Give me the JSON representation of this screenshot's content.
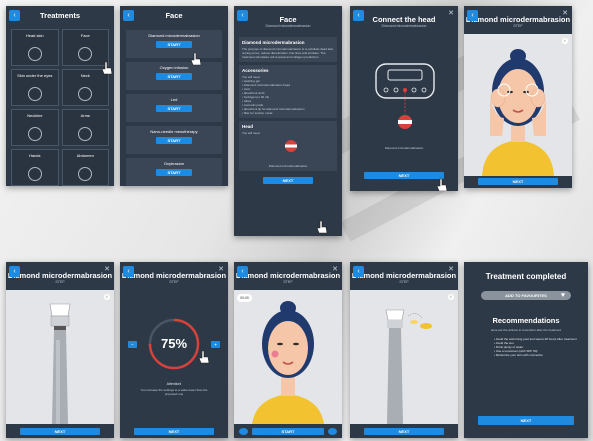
{
  "screens": {
    "treatments": {
      "title": "Treatments",
      "items": [
        {
          "label": "Head skin",
          "icon": "head-icon"
        },
        {
          "label": "Face",
          "icon": "face-icon"
        },
        {
          "label": "Skin under the eyes",
          "icon": "eyes-icon"
        },
        {
          "label": "Neck",
          "icon": "neck-icon"
        },
        {
          "label": "Neckline",
          "icon": "neckline-icon"
        },
        {
          "label": "Arms",
          "icon": "arms-icon"
        },
        {
          "label": "Hands",
          "icon": "hands-icon"
        },
        {
          "label": "Abdomen",
          "icon": "abdomen-icon"
        }
      ]
    },
    "face": {
      "title": "Face",
      "items": [
        {
          "label": "Diamond microdermabrasion",
          "button": "START"
        },
        {
          "label": "Oxygen infusion",
          "button": "START"
        },
        {
          "label": "Led",
          "button": "START"
        },
        {
          "label": "Nano-needle mesotherapy",
          "button": "START"
        },
        {
          "label": "Oxybrasion",
          "button": "START"
        }
      ]
    },
    "face_detail": {
      "title": "Face",
      "subtitle": "Diamond microdermabrasion",
      "panel_title": "Diamond microdermabrasion",
      "panel_text": "The purpose of diamond microdermabrasion is to exfoliate dead skin, unclog pores, reduce discoloration, fine lines and wrinkles. The treatment stimulates cell renewal and collagen production.",
      "accessories_title": "Accessories",
      "accessories_sub": "You will need",
      "accessories": [
        "washing gel",
        "Diamond microdermabrasion head",
        "tonic",
        "absorbent cloth",
        "hydrogel (or 20 ml)",
        "tubes",
        "cosmetic pads",
        "absorbent tip for diamond microdermabrasion",
        "filter for suction mode"
      ],
      "head_title": "Head",
      "head_sub": "You will need",
      "head_label": "Diamond microdermabrasion",
      "next": "NEXT"
    },
    "connect": {
      "title": "Connect the head",
      "subtitle": "Diamond microdermabrasion",
      "device_label": "Diamond microdermabrasion",
      "next": "NEXT"
    },
    "diamond1": {
      "title": "Diamond microdermabrasion",
      "sub": "STEP",
      "next": "NEXT"
    },
    "diamond2": {
      "title": "Diamond microdermabrasion",
      "sub": "STEP",
      "next": "NEXT"
    },
    "diamond3": {
      "title": "Diamond microdermabrasion",
      "sub": "STEP",
      "percent": "75%",
      "percent_value": 75,
      "attention": "Attention!",
      "attention_text": "You increase the settings to a value lower than the proposed one",
      "next": "NEXT",
      "minus": "−",
      "plus": "+"
    },
    "diamond4": {
      "title": "Diamond microdermabrasion",
      "sub": "STEP",
      "timer": "00:00",
      "start": "START"
    },
    "diamond5": {
      "title": "Diamond microdermabrasion",
      "sub": "STEP",
      "next": "NEXT"
    },
    "completed": {
      "title": "Treatment completed",
      "favourites": "ADD TO FAVOURITES",
      "rec_title": "Recommendations",
      "rec_sub": "Here are the actions to remember after the treatment",
      "recs": [
        "Avoid the swimming pool and sauna 48 hours after treatment",
        "Avoid the sun",
        "Drink plenty of water",
        "Use a sunscreen (with SPF 50)",
        "Moisturize your skin with cosmetics"
      ],
      "next": "NEXT"
    }
  },
  "colors": {
    "panel": "#2e3947",
    "accent": "#1f8be0",
    "skin": "#f6c6a8",
    "hair": "#213a6e",
    "shirt": "#f2c230",
    "ring": "#d8403a"
  }
}
